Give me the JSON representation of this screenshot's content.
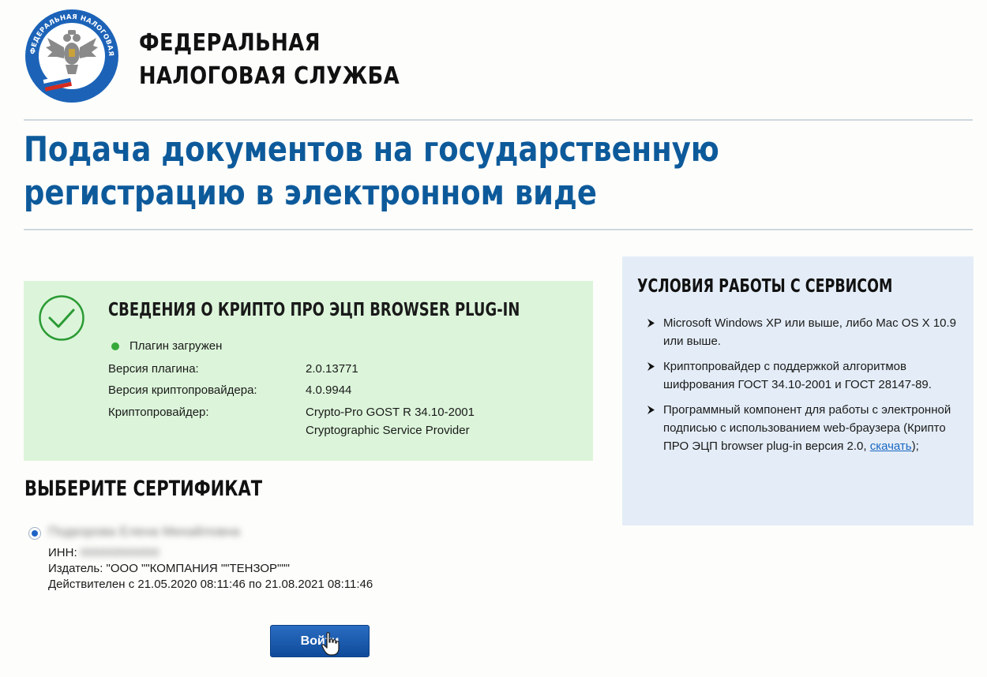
{
  "header": {
    "org_line1": "ФЕДЕРАЛЬНАЯ",
    "org_line2": "НАЛОГОВАЯ СЛУЖБА",
    "logo_text": "ФЕДЕРАЛЬНАЯ НАЛОГОВАЯ СЛУЖБА"
  },
  "page_title": "Подача документов на государственную регистрацию в электронном виде",
  "plugin_info": {
    "title": "СВЕДЕНИЯ О КРИПТО ПРО ЭЦП BROWSER PLUG-IN",
    "status": "Плагин загружен",
    "rows": [
      {
        "label": "Версия плагина:",
        "value": "2.0.13771"
      },
      {
        "label": "Версия криптопровайдера:",
        "value": "4.0.9944"
      },
      {
        "label": "Криптопровайдер:",
        "value": "Crypto-Pro GOST R 34.10-2001",
        "value2": "Cryptographic Service Provider"
      }
    ]
  },
  "certificate": {
    "section_title": "ВЫБЕРИТЕ СЕРТИФИКАТ",
    "holder_name": "Подкорова Елена Михайловна",
    "inn_label": "ИНН:",
    "inn_value": "000000000000",
    "issuer": "Издатель: \"ООО \"\"КОМПАНИЯ \"\"ТЕНЗОР\"\"\"",
    "validity": "Действителен с 21.05.2020 08:11:46 по 21.08.2021 08:11:46",
    "selected": true
  },
  "login_button": "Войти",
  "terms": {
    "title": "УСЛОВИЯ РАБОТЫ С СЕРВИСОМ",
    "item1": "Microsoft Windows XP или выше, либо Mac OS X 10.9 или выше.",
    "item2": "Криптопровайдер с поддержкой алгоритмов шифрования ГОСТ 34.10-2001 и ГОСТ 28147-89.",
    "item3_text": "Программный компонент для работы с электронной подписью с использованием web-браузера (Крипто ПРО ЭЦП browser plug-in версия 2.0, ",
    "item3_link": "скачать",
    "item3_tail": ");"
  },
  "colors": {
    "title_blue": "#0d5a9b",
    "info_panel_green": "#dcf5da",
    "terms_panel_blue": "#e4edf7",
    "status_green": "#35a83a",
    "button_blue": "#1a5cb0",
    "link_blue": "#1a67c2"
  },
  "icons": {
    "logo": "fns-emblem-icon",
    "status_ok": "check-circle-icon",
    "bullets": "arrow-bullet-icon",
    "cursor": "hand-pointer-icon"
  }
}
